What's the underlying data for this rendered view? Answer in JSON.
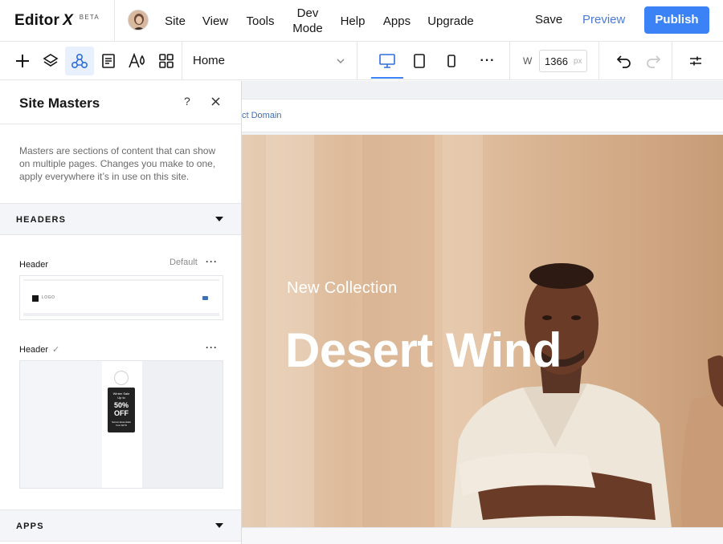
{
  "app": {
    "name": "Editor",
    "logo_mark": "X",
    "badge": "BETA"
  },
  "topbar": {
    "menu": [
      "Site",
      "View",
      "Tools",
      "Dev Mode",
      "Help",
      "Apps",
      "Upgrade"
    ],
    "save_label": "Save",
    "preview_label": "Preview",
    "publish_label": "Publish"
  },
  "toolbar": {
    "tools": [
      "add-icon",
      "layers-icon",
      "masters-icon",
      "pages-icon",
      "design-icon",
      "apps-grid-icon"
    ],
    "active_tool": "masters-icon",
    "page_select": {
      "value": "Home"
    },
    "devices": [
      "desktop-icon",
      "tablet-icon",
      "mobile-icon"
    ],
    "active_device": "desktop-icon",
    "more_label": "···",
    "width_label": "W",
    "width_value": "1366",
    "width_unit": "px"
  },
  "panel": {
    "title": "Site Masters",
    "help_label": "?",
    "description": "Masters are sections of content that can show on multiple pages. Changes you make to one, apply everywhere it’s in use on this site.",
    "sections": [
      {
        "label": "HEADERS",
        "items": [
          {
            "name": "Header",
            "tag": "Default",
            "menu": "···",
            "thumb_logo": "LOGO"
          },
          {
            "name": "Header",
            "tag": "✓",
            "menu": "···",
            "thumb_promo": {
              "line1": "Winter Sale",
              "line2": "Up to",
              "big1": "50%",
              "big2": "OFF",
              "small1": "Swoon Essentials",
              "small2": "from $179"
            }
          }
        ]
      },
      {
        "label": "APPS"
      }
    ]
  },
  "canvas": {
    "domain_link": "ct Domain",
    "hero_subtitle": "New Collection",
    "hero_title": "Desert Wind"
  },
  "colors": {
    "accent": "#3b82f6",
    "preview": "#4a7ad6",
    "hero_bg": "#ddbb9a"
  }
}
